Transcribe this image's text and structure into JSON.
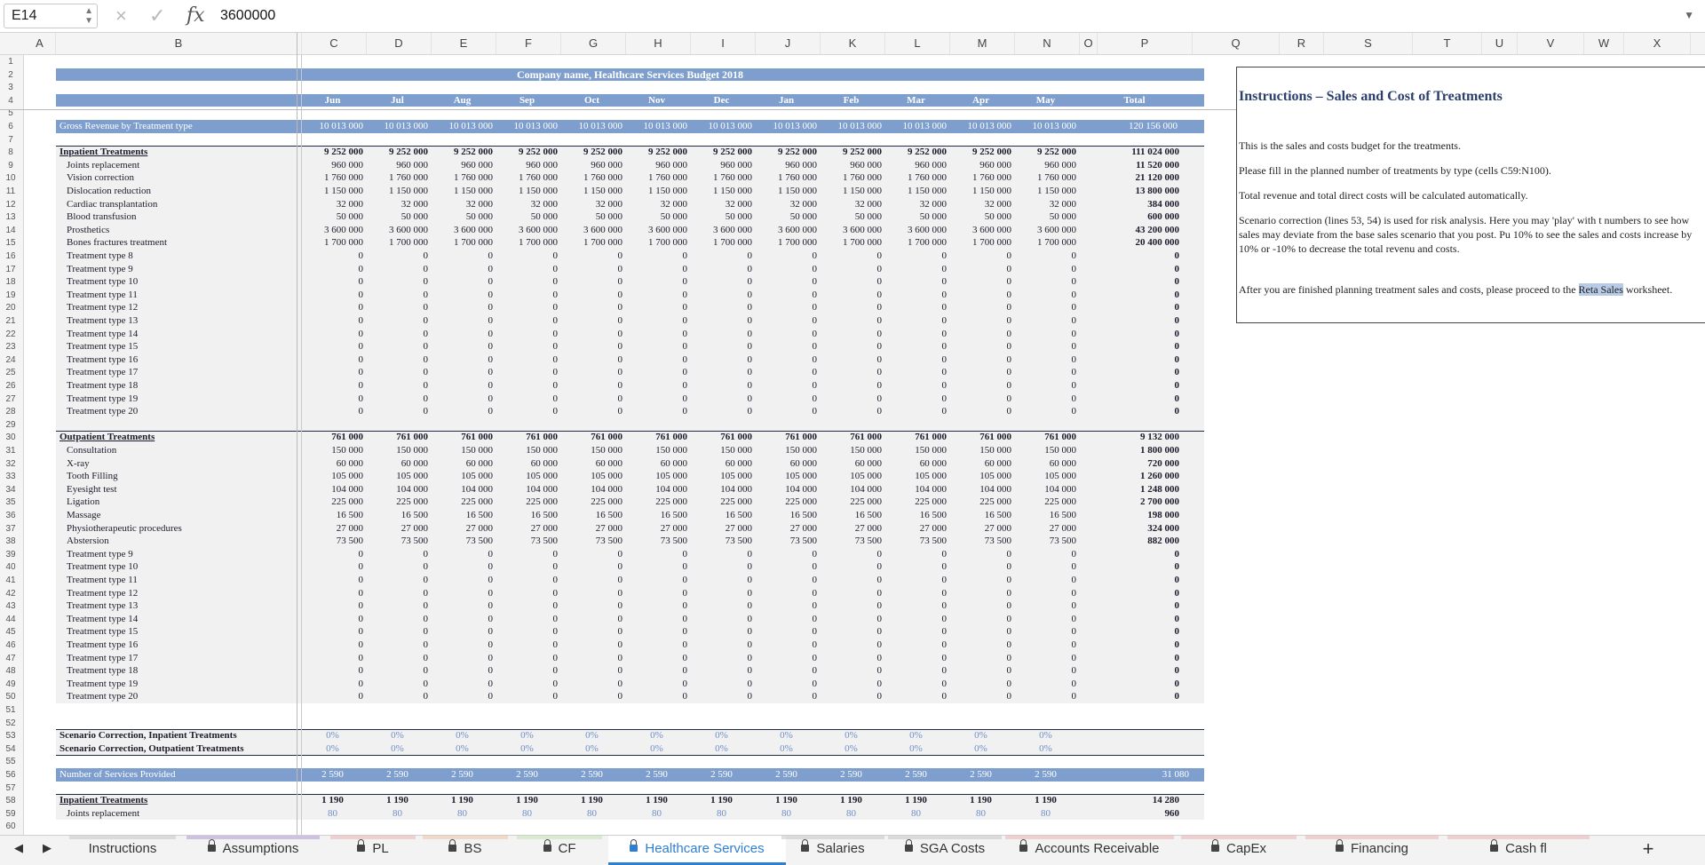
{
  "formula_bar": {
    "cell_ref": "E14",
    "formula": "3600000",
    "fx": "fx",
    "cancel_icon": "×",
    "confirm_icon": "✓"
  },
  "columns": [
    "A",
    "B",
    "C",
    "D",
    "E",
    "F",
    "G",
    "H",
    "I",
    "J",
    "K",
    "L",
    "M",
    "N",
    "O",
    "P",
    "Q",
    "R",
    "S",
    "T",
    "U",
    "V",
    "W",
    "X",
    "Y"
  ],
  "title": "Company name, Healthcare Services Budget 2018",
  "months": [
    "Jun",
    "Jul",
    "Aug",
    "Sep",
    "Oct",
    "Nov",
    "Dec",
    "Jan",
    "Feb",
    "Mar",
    "Apr",
    "May",
    "Total"
  ],
  "gross_revenue": {
    "label": "Gross Revenue by Treatment type",
    "values": [
      "10 013 000",
      "10 013 000",
      "10 013 000",
      "10 013 000",
      "10 013 000",
      "10 013 000",
      "10 013 000",
      "10 013 000",
      "10 013 000",
      "10 013 000",
      "10 013 000",
      "10 013 000",
      "120 156 000"
    ]
  },
  "inpatient": {
    "label": "Inpatient Treatments",
    "values": [
      "9 252 000",
      "9 252 000",
      "9 252 000",
      "9 252 000",
      "9 252 000",
      "9 252 000",
      "9 252 000",
      "9 252 000",
      "9 252 000",
      "9 252 000",
      "9 252 000",
      "9 252 000",
      "111 024 000"
    ],
    "rows": [
      {
        "label": "Joints replacement",
        "v": "960 000",
        "t": "11 520 000"
      },
      {
        "label": "Vision correction",
        "v": "1 760 000",
        "t": "21 120 000"
      },
      {
        "label": "Dislocation reduction",
        "v": "1 150 000",
        "t": "13 800 000"
      },
      {
        "label": "Cardiac transplantation",
        "v": "32 000",
        "t": "384 000"
      },
      {
        "label": "Blood transfusion",
        "v": "50 000",
        "t": "600 000"
      },
      {
        "label": "Prosthetics",
        "v": "3 600 000",
        "t": "43 200 000"
      },
      {
        "label": "Bones fractures treatment",
        "v": "1 700 000",
        "t": "20 400 000"
      },
      {
        "label": "Treatment type 8",
        "v": "0",
        "t": "0"
      },
      {
        "label": "Treatment type 9",
        "v": "0",
        "t": "0"
      },
      {
        "label": "Treatment type 10",
        "v": "0",
        "t": "0"
      },
      {
        "label": "Treatment type 11",
        "v": "0",
        "t": "0"
      },
      {
        "label": "Treatment type 12",
        "v": "0",
        "t": "0"
      },
      {
        "label": "Treatment type 13",
        "v": "0",
        "t": "0"
      },
      {
        "label": "Treatment type 14",
        "v": "0",
        "t": "0"
      },
      {
        "label": "Treatment type 15",
        "v": "0",
        "t": "0"
      },
      {
        "label": "Treatment type 16",
        "v": "0",
        "t": "0"
      },
      {
        "label": "Treatment type 17",
        "v": "0",
        "t": "0"
      },
      {
        "label": "Treatment type 18",
        "v": "0",
        "t": "0"
      },
      {
        "label": "Treatment type 19",
        "v": "0",
        "t": "0"
      },
      {
        "label": "Treatment type 20",
        "v": "0",
        "t": "0"
      }
    ]
  },
  "outpatient": {
    "label": "Outpatient Treatments",
    "values": [
      "761 000",
      "761 000",
      "761 000",
      "761 000",
      "761 000",
      "761 000",
      "761 000",
      "761 000",
      "761 000",
      "761 000",
      "761 000",
      "761 000",
      "9 132 000"
    ],
    "rows": [
      {
        "label": "Consultation",
        "v": "150 000",
        "t": "1 800 000"
      },
      {
        "label": "X-ray",
        "v": "60 000",
        "t": "720 000"
      },
      {
        "label": "Tooth Filling",
        "v": "105 000",
        "t": "1 260 000"
      },
      {
        "label": "Eyesight test",
        "v": "104 000",
        "t": "1 248 000"
      },
      {
        "label": "Ligation",
        "v": "225 000",
        "t": "2 700 000"
      },
      {
        "label": "Massage",
        "v": "16 500",
        "t": "198 000"
      },
      {
        "label": "Physiotherapeutic procedures",
        "v": "27 000",
        "t": "324 000"
      },
      {
        "label": "Abstersion",
        "v": "73 500",
        "t": "882 000"
      },
      {
        "label": "Treatment type 9",
        "v": "0",
        "t": "0"
      },
      {
        "label": "Treatment type 10",
        "v": "0",
        "t": "0"
      },
      {
        "label": "Treatment type 11",
        "v": "0",
        "t": "0"
      },
      {
        "label": "Treatment type 12",
        "v": "0",
        "t": "0"
      },
      {
        "label": "Treatment type 13",
        "v": "0",
        "t": "0"
      },
      {
        "label": "Treatment type 14",
        "v": "0",
        "t": "0"
      },
      {
        "label": "Treatment type 15",
        "v": "0",
        "t": "0"
      },
      {
        "label": "Treatment type 16",
        "v": "0",
        "t": "0"
      },
      {
        "label": "Treatment type 17",
        "v": "0",
        "t": "0"
      },
      {
        "label": "Treatment type 18",
        "v": "0",
        "t": "0"
      },
      {
        "label": "Treatment type 19",
        "v": "0",
        "t": "0"
      },
      {
        "label": "Treatment type 20",
        "v": "0",
        "t": "0"
      }
    ]
  },
  "scenario": [
    {
      "label": "Scenario Correction, Inpatient Treatments",
      "v": "0%"
    },
    {
      "label": "Scenario Correction, Outpatient Treatments",
      "v": "0%"
    }
  ],
  "services": {
    "label": "Number of Services Provided",
    "v": "2 590",
    "t": "31 080"
  },
  "inpatient_count": {
    "label": "Inpatient Treatments",
    "v": "1 190",
    "t": "14 280"
  },
  "joints_count": {
    "label": "Joints replacement",
    "v": "80",
    "t": "960"
  },
  "instructions": {
    "title": "Instructions – Sales and Cost of Treatments",
    "p1": "This is the sales and costs budget for the treatments.",
    "p2": "Please fill in the planned number of treatments by type (cells C59:N100).",
    "p3": "Total revenue and total direct costs will be calculated automatically.",
    "p4": "Scenario correction (lines 53, 54) is used for risk analysis. Here you may 'play' with t numbers to see how sales may deviate from the base sales scenario that you post. Pu 10% to see the sales and costs increase by 10% or -10% to decrease the total revenu and costs.",
    "p5a": "After you are finished planning treatment sales and costs, please proceed to the ",
    "p5_link": "Reta Sales",
    "p5b": " worksheet."
  },
  "tabs": [
    {
      "label": "Instructions",
      "locked": false,
      "color": "#c9c9c9"
    },
    {
      "label": "Assumptions",
      "locked": true,
      "color": "#b99fd8"
    },
    {
      "label": "PL",
      "locked": true,
      "color": "#f1b7b7"
    },
    {
      "label": "BS",
      "locked": true,
      "color": "#f4c6a8"
    },
    {
      "label": "CF",
      "locked": true,
      "color": "#c8e6b5"
    },
    {
      "label": "Healthcare Services",
      "locked": true,
      "color": "#2f7fd0",
      "active": true
    },
    {
      "label": "Salaries",
      "locked": true,
      "color": "#c9c9c9"
    },
    {
      "label": "SGA Costs",
      "locked": true,
      "color": "#c9c9c9"
    },
    {
      "label": "Accounts Receivable",
      "locked": true,
      "color": "#f1b7b7"
    },
    {
      "label": "CapEx",
      "locked": true,
      "color": "#f1b7b7"
    },
    {
      "label": "Financing",
      "locked": true,
      "color": "#f1b7b7"
    },
    {
      "label": "Cash fl",
      "locked": true,
      "color": "#f1b7b7"
    }
  ],
  "add_sheet": "+"
}
